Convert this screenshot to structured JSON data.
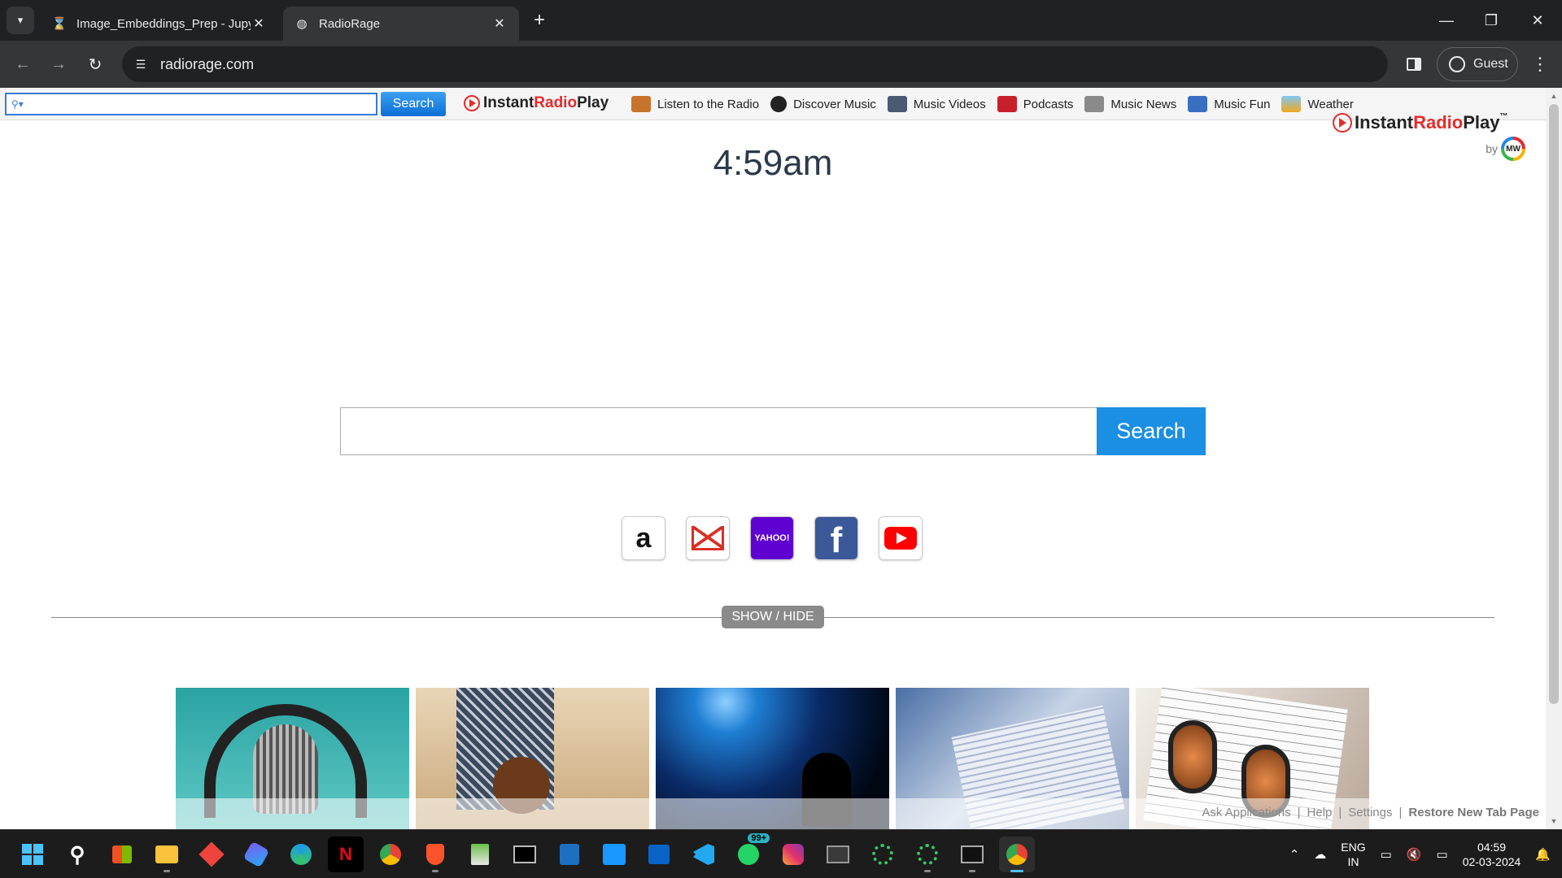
{
  "browser": {
    "tabs": [
      {
        "title": "Image_Embeddings_Prep - Jupy",
        "favicon": "hourglass-icon",
        "active": false
      },
      {
        "title": "RadioRage",
        "favicon": "globe-icon",
        "active": true
      }
    ],
    "url": "radiorage.com",
    "profile_label": "Guest"
  },
  "extension_bar": {
    "search_placeholder": "",
    "search_button": "Search",
    "logo_part1": "Instant",
    "logo_part2": "Radio",
    "logo_part3": "Play",
    "links": [
      {
        "label": "Listen to the Radio",
        "icon": "radio-icon",
        "color": "#c8732a"
      },
      {
        "label": "Discover Music",
        "icon": "disc-icon",
        "color": "#222222"
      },
      {
        "label": "Music Videos",
        "icon": "video-icon",
        "color": "#4a5a72"
      },
      {
        "label": "Podcasts",
        "icon": "podcast-icon",
        "color": "#c8202a"
      },
      {
        "label": "Music News",
        "icon": "news-icon",
        "color": "#8a8a8a"
      },
      {
        "label": "Music Fun",
        "icon": "star-icon",
        "color": "#3a6fc0"
      },
      {
        "label": "Weather",
        "icon": "weather-icon",
        "color": "#f0a820"
      }
    ]
  },
  "page": {
    "time": "4:59am",
    "brand_part1": "Instant",
    "brand_part2": "Radio",
    "brand_part3": "Play",
    "brand_tm": "™",
    "brand_by": "by",
    "brand_mw": "MW",
    "search_button": "Search",
    "quick_links": [
      {
        "name": "amazon",
        "label": "a"
      },
      {
        "name": "gmail",
        "label": ""
      },
      {
        "name": "yahoo",
        "label": "YAHOO!"
      },
      {
        "name": "facebook",
        "label": "f"
      },
      {
        "name": "youtube",
        "label": ""
      }
    ],
    "show_hide": "SHOW / HIDE",
    "footer": {
      "ask_applications": "Ask Applications",
      "help": "Help",
      "settings": "Settings",
      "restore": "Restore New Tab Page",
      "separator": "|"
    }
  },
  "taskbar": {
    "apps": [
      "start",
      "search",
      "store",
      "file-explorer",
      "anydesk",
      "copilot",
      "edge",
      "netflix",
      "chrome",
      "brave",
      "notepad",
      "cmd",
      "calculator",
      "prime-video",
      "outlook",
      "vscode",
      "whatsapp",
      "instagram",
      "terminal-window",
      "loader-1",
      "loader-2",
      "terminal",
      "chrome-active"
    ],
    "whatsapp_badge": "99+",
    "lang_top": "ENG",
    "lang_bottom": "IN",
    "time": "04:59",
    "date": "02-03-2024"
  }
}
